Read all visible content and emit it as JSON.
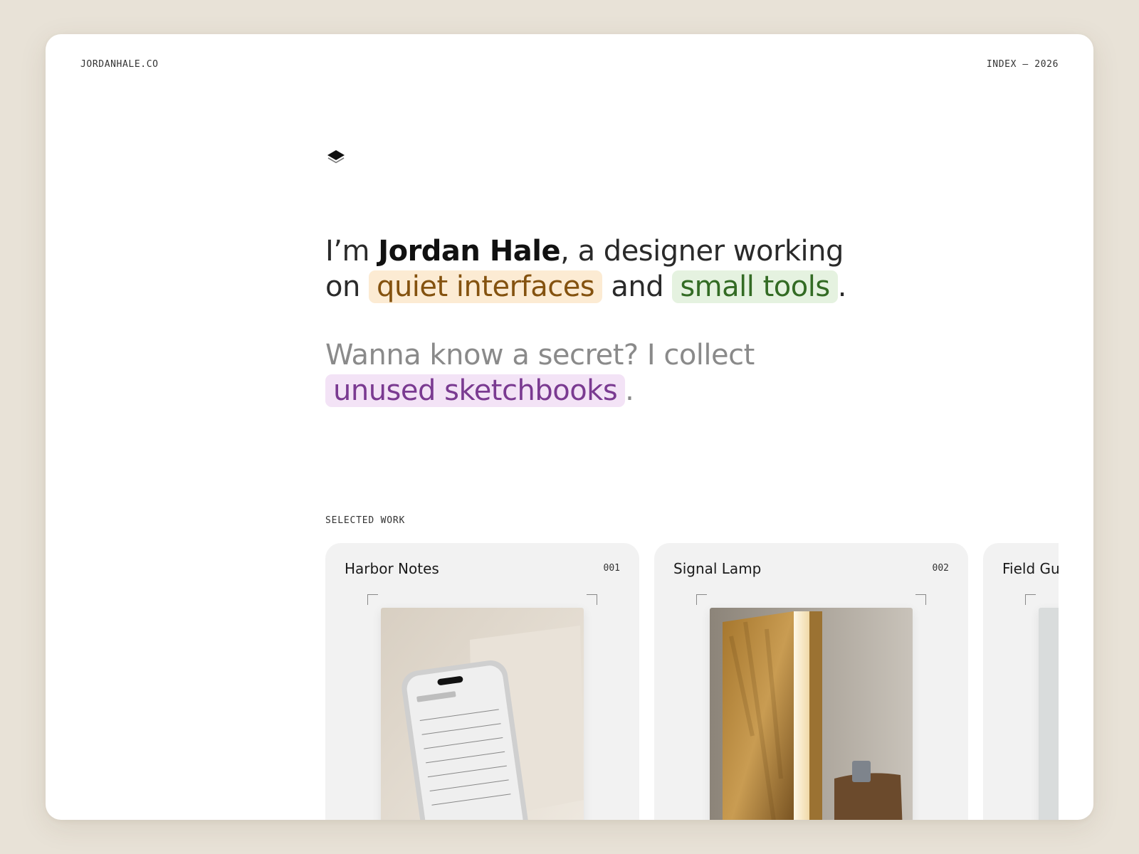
{
  "header": {
    "site_name": "JORDANHALE.CO",
    "index_label": "INDEX — 2026"
  },
  "logo": {
    "icon": "layers-icon"
  },
  "hero": {
    "intro_prefix": "I’m ",
    "name": "Jordan Hale",
    "intro_mid": ", a designer working on ",
    "highlight_1": "quiet interfaces",
    "connector": " and ",
    "highlight_2": "small tools",
    "end_1": ".",
    "secret_prefix": "Wanna know a secret? I collect ",
    "highlight_3": "unused sketchbooks",
    "end_2": "."
  },
  "colors": {
    "page_bg": "#e8e2d7",
    "amber_bg": "#fcebd3",
    "amber_text": "#84520f",
    "green_bg": "#e5f2e0",
    "green_text": "#336b24",
    "purple_bg": "#f3e3f6",
    "purple_text": "#7a3a91"
  },
  "work": {
    "label": "SELECTED WORK",
    "cards": [
      {
        "title": "Harbor Notes",
        "number": "001",
        "image": "phone-mockup-image"
      },
      {
        "title": "Signal Lamp",
        "number": "002",
        "image": "wood-lamp-image"
      },
      {
        "title": "Field Gui",
        "number": "",
        "image": "field-guide-image"
      }
    ]
  }
}
